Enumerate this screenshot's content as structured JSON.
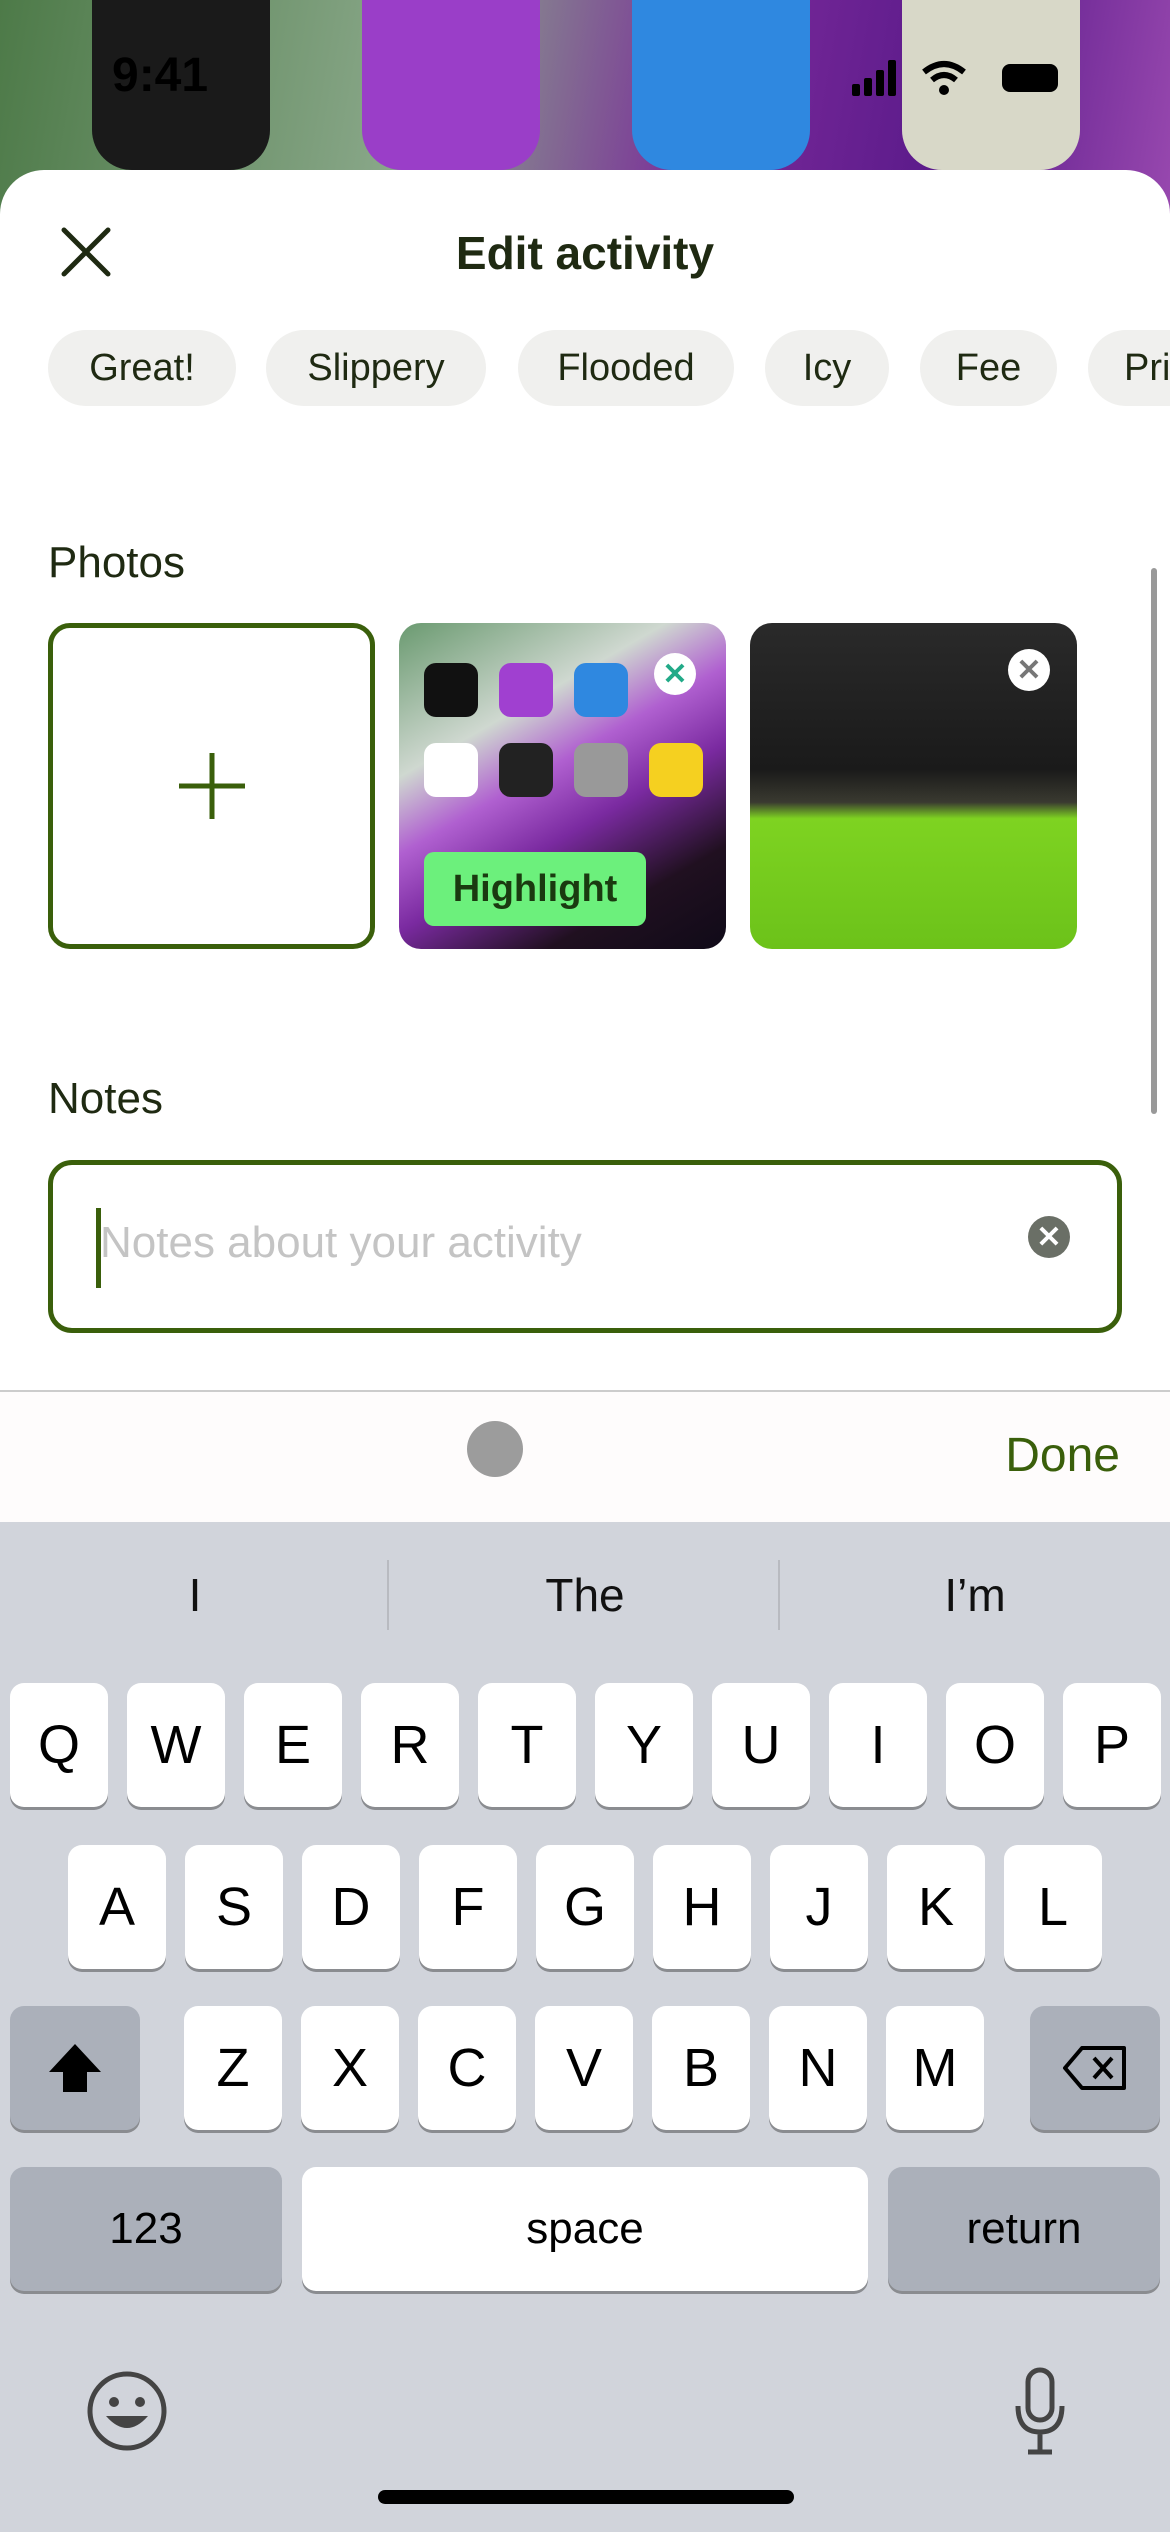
{
  "status_bar": {
    "time": "9:41"
  },
  "header": {
    "title": "Edit activity",
    "close_icon": "close-icon"
  },
  "chips": [
    "Great!",
    "Slippery",
    "Flooded",
    "Icy",
    "Fee",
    "Pri"
  ],
  "photos": {
    "label": "Photos",
    "add_icon": "plus-icon",
    "images": [
      {
        "badge": "Highlight"
      },
      {}
    ]
  },
  "notes": {
    "label": "Notes",
    "placeholder": "Notes about your activity",
    "value": ""
  },
  "toolbar": {
    "done_label": "Done"
  },
  "keyboard": {
    "suggestions": [
      "I",
      "The",
      "I’m"
    ],
    "rows": [
      [
        "Q",
        "W",
        "E",
        "R",
        "T",
        "Y",
        "U",
        "I",
        "O",
        "P"
      ],
      [
        "A",
        "S",
        "D",
        "F",
        "G",
        "H",
        "J",
        "K",
        "L"
      ],
      [
        "Z",
        "X",
        "C",
        "V",
        "B",
        "N",
        "M"
      ]
    ],
    "numbers_label": "123",
    "space_label": "space",
    "return_label": "return"
  },
  "colors": {
    "accent": "#3a5f0b",
    "highlight": "#6cf07c",
    "keyboard_bg": "#d1d4db"
  }
}
